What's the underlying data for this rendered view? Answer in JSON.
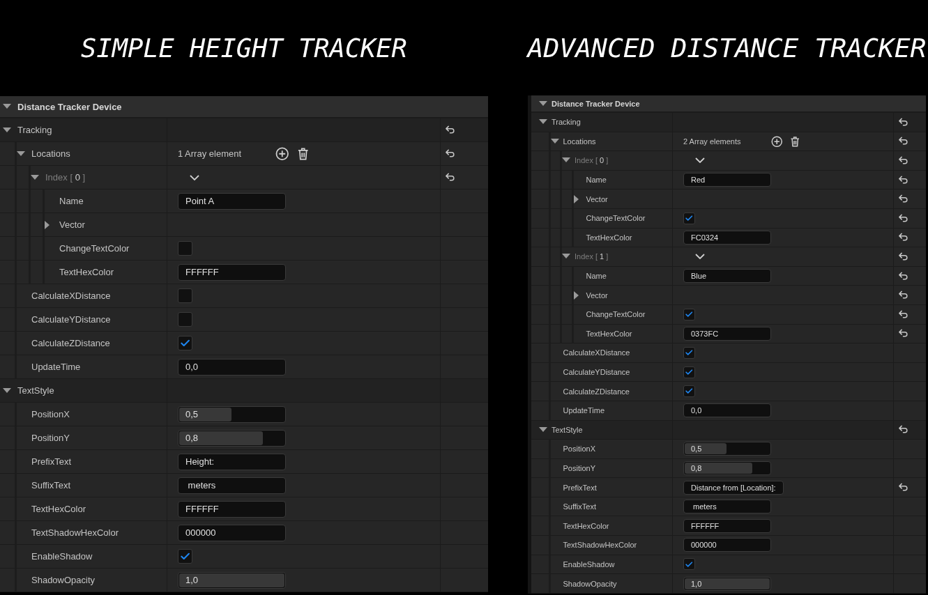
{
  "panels": [
    {
      "heading": "SIMPLE HEIGHT TRACKER",
      "title": "Distance Tracker Device",
      "expanded": true,
      "rows": [
        {
          "kind": "group",
          "label": "Tracking",
          "expanded": true,
          "reset": true,
          "children": [
            {
              "kind": "array",
              "label": "Locations",
              "value": "1 Array element",
              "expanded": true,
              "reset": true,
              "children": [
                {
                  "kind": "index",
                  "label": "Index [ **0** ]",
                  "expanded": true,
                  "reset": true,
                  "children": [
                    {
                      "kind": "text",
                      "label": "Name",
                      "value": "Point A",
                      "reset": false
                    },
                    {
                      "kind": "struct",
                      "label": "Vector",
                      "expanded": false,
                      "reset": false
                    },
                    {
                      "kind": "check",
                      "label": "ChangeTextColor",
                      "checked": false,
                      "reset": false
                    },
                    {
                      "kind": "text",
                      "label": "TextHexColor",
                      "value": "FFFFFF",
                      "reset": false
                    }
                  ]
                }
              ]
            },
            {
              "kind": "check",
              "label": "CalculateXDistance",
              "checked": false,
              "reset": false
            },
            {
              "kind": "check",
              "label": "CalculateYDistance",
              "checked": false,
              "reset": false
            },
            {
              "kind": "check",
              "label": "CalculateZDistance",
              "checked": true,
              "reset": false
            },
            {
              "kind": "text",
              "label": "UpdateTime",
              "value": "0,0",
              "reset": false
            }
          ]
        },
        {
          "kind": "group",
          "label": "TextStyle",
          "expanded": true,
          "reset": false,
          "children": [
            {
              "kind": "slider",
              "label": "PositionX",
              "value": "0,5",
              "level": 0.5,
              "reset": false
            },
            {
              "kind": "slider",
              "label": "PositionY",
              "value": "0,8",
              "level": 0.8,
              "reset": false
            },
            {
              "kind": "text",
              "label": "PrefixText",
              "value": "Height:",
              "reset": false
            },
            {
              "kind": "text",
              "label": "SuffixText",
              "value": " meters",
              "reset": false
            },
            {
              "kind": "text",
              "label": "TextHexColor",
              "value": "FFFFFF",
              "reset": false
            },
            {
              "kind": "text",
              "label": "TextShadowHexColor",
              "value": "000000",
              "reset": false
            },
            {
              "kind": "check",
              "label": "EnableShadow",
              "checked": true,
              "reset": false
            },
            {
              "kind": "slider",
              "label": "ShadowOpacity",
              "value": "1,0",
              "level": 1.0,
              "reset": false
            }
          ]
        }
      ]
    },
    {
      "heading": "ADVANCED DISTANCE TRACKER",
      "title": "Distance Tracker Device",
      "expanded": true,
      "rows": [
        {
          "kind": "group",
          "label": "Tracking",
          "expanded": true,
          "reset": true,
          "children": [
            {
              "kind": "array",
              "label": "Locations",
              "value": "2 Array elements",
              "expanded": true,
              "reset": true,
              "children": [
                {
                  "kind": "index",
                  "label": "Index [ **0** ]",
                  "expanded": true,
                  "reset": true,
                  "children": [
                    {
                      "kind": "text",
                      "label": "Name",
                      "value": "Red",
                      "reset": true
                    },
                    {
                      "kind": "struct",
                      "label": "Vector",
                      "expanded": false,
                      "reset": true
                    },
                    {
                      "kind": "check",
                      "label": "ChangeTextColor",
                      "checked": true,
                      "reset": true
                    },
                    {
                      "kind": "text",
                      "label": "TextHexColor",
                      "value": "FC0324",
                      "reset": true
                    }
                  ]
                },
                {
                  "kind": "index",
                  "label": "Index [ **1** ]",
                  "expanded": true,
                  "reset": true,
                  "children": [
                    {
                      "kind": "text",
                      "label": "Name",
                      "value": "Blue",
                      "reset": true
                    },
                    {
                      "kind": "struct",
                      "label": "Vector",
                      "expanded": false,
                      "reset": true
                    },
                    {
                      "kind": "check",
                      "label": "ChangeTextColor",
                      "checked": true,
                      "reset": true
                    },
                    {
                      "kind": "text",
                      "label": "TextHexColor",
                      "value": "0373FC",
                      "reset": true
                    }
                  ]
                }
              ]
            },
            {
              "kind": "check",
              "label": "CalculateXDistance",
              "checked": true,
              "reset": false
            },
            {
              "kind": "check",
              "label": "CalculateYDistance",
              "checked": true,
              "reset": false
            },
            {
              "kind": "check",
              "label": "CalculateZDistance",
              "checked": true,
              "reset": false
            },
            {
              "kind": "text",
              "label": "UpdateTime",
              "value": "0,0",
              "reset": false
            }
          ]
        },
        {
          "kind": "group",
          "label": "TextStyle",
          "expanded": true,
          "reset": true,
          "children": [
            {
              "kind": "slider",
              "label": "PositionX",
              "value": "0,5",
              "level": 0.5,
              "reset": false
            },
            {
              "kind": "slider",
              "label": "PositionY",
              "value": "0,8",
              "level": 0.8,
              "reset": false
            },
            {
              "kind": "text",
              "label": "PrefixText",
              "value": "Distance from [Location]:",
              "reset": true
            },
            {
              "kind": "text",
              "label": "SuffixText",
              "value": " meters",
              "reset": false
            },
            {
              "kind": "text",
              "label": "TextHexColor",
              "value": "FFFFFF",
              "reset": false
            },
            {
              "kind": "text",
              "label": "TextShadowHexColor",
              "value": "000000",
              "reset": false
            },
            {
              "kind": "check",
              "label": "EnableShadow",
              "checked": true,
              "reset": false
            },
            {
              "kind": "slider",
              "label": "ShadowOpacity",
              "value": "1,0",
              "level": 1.0,
              "reset": false
            }
          ]
        }
      ]
    }
  ]
}
